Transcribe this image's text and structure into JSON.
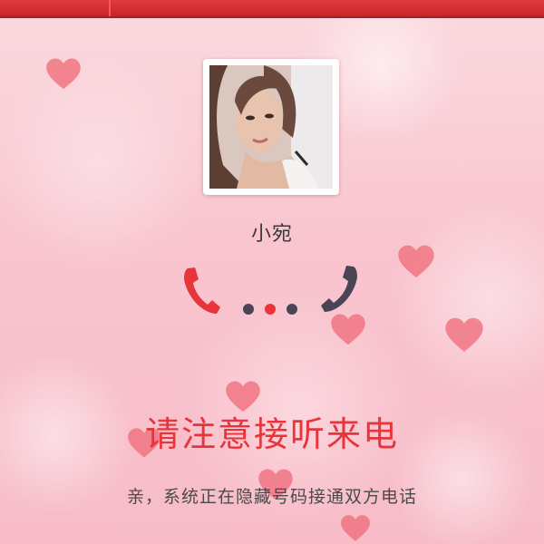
{
  "caller": {
    "name": "小宛",
    "avatar_alt": "caller avatar photo"
  },
  "call_status": {
    "indicator_dots": [
      {
        "color": "#4b4454"
      },
      {
        "color": "#e8343b"
      },
      {
        "color": "#4b4454"
      }
    ],
    "left_icon": "phone-handset-icon",
    "left_icon_color": "#e8343b",
    "right_icon": "phone-handset-icon",
    "right_icon_color": "#4b4454"
  },
  "notice": {
    "title": "请注意接听来电",
    "subtitle": "亲，系统正在隐藏号码接通双方电话"
  },
  "theme": {
    "accent": "#e8343b",
    "top_bar": "#d42f34",
    "background": "#f9c5cf"
  }
}
